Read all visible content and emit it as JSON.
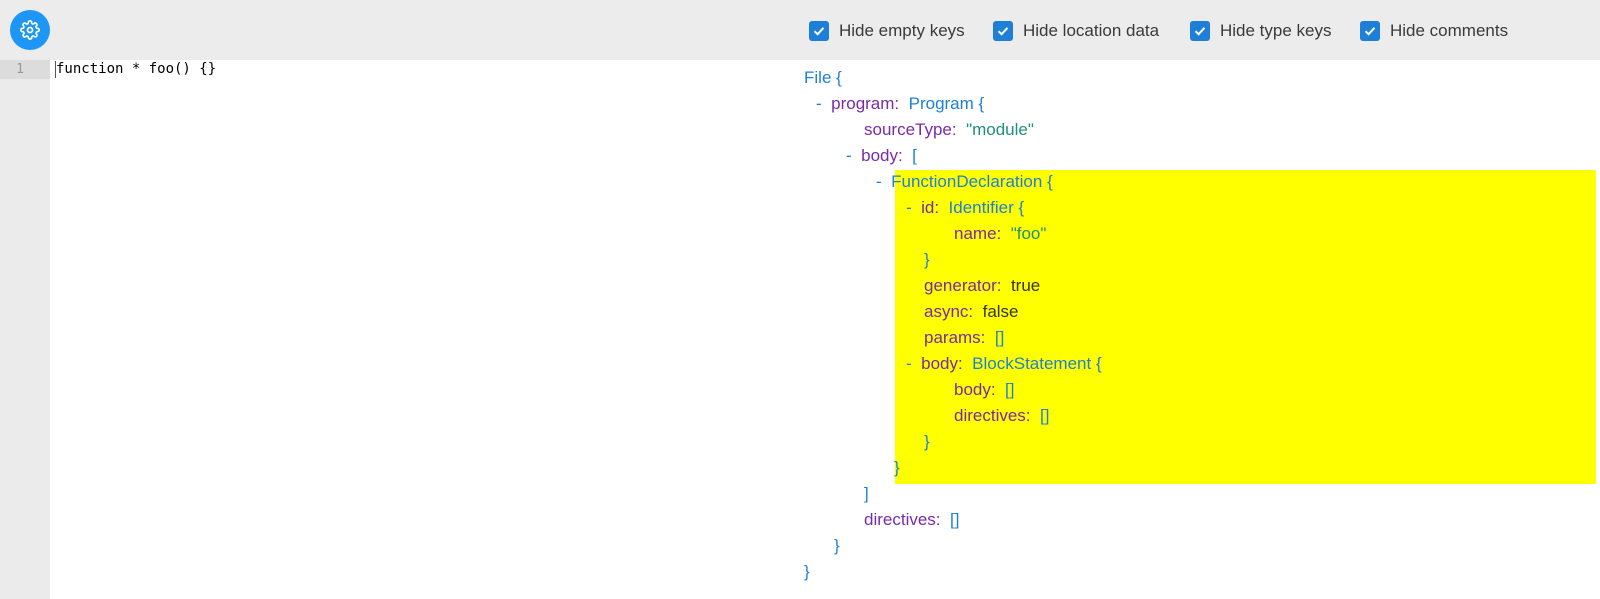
{
  "editor": {
    "line_number": "1",
    "code": "function * foo() {}"
  },
  "options": [
    {
      "label": "Hide empty keys",
      "checked": true
    },
    {
      "label": "Hide location data",
      "checked": true
    },
    {
      "label": "Hide type keys",
      "checked": true
    },
    {
      "label": "Hide comments",
      "checked": true
    }
  ],
  "ast": {
    "collapse_symbol": "-",
    "lines": {
      "file_type": "File",
      "program_key": "program:",
      "program_type": "Program",
      "sourcetype_key": "sourceType:",
      "sourcetype_val": "\"module\"",
      "body_key": "body:",
      "funcdecl_type": "FunctionDeclaration",
      "id_key": "id:",
      "identifier_type": "Identifier",
      "name_key": "name:",
      "name_val": "\"foo\"",
      "generator_key": "generator:",
      "generator_val": "true",
      "async_key": "async:",
      "async_val": "false",
      "params_key": "params:",
      "params_val": "[]",
      "inner_body_key": "body:",
      "blockstatement_type": "BlockStatement",
      "block_body_key": "body:",
      "block_body_val": "[]",
      "block_directives_key": "directives:",
      "block_directives_val": "[]",
      "directives_key": "directives:",
      "directives_val": "[]",
      "open_brace": "{",
      "close_brace": "}",
      "open_bracket": "[",
      "close_bracket": "]"
    }
  },
  "colors": {
    "accent": "#1e96f5",
    "checkbox": "#1e7fd8",
    "highlight": "#ffff00",
    "key": "#7a2aa8",
    "type": "#1e7fd8",
    "string": "#208f7d"
  }
}
